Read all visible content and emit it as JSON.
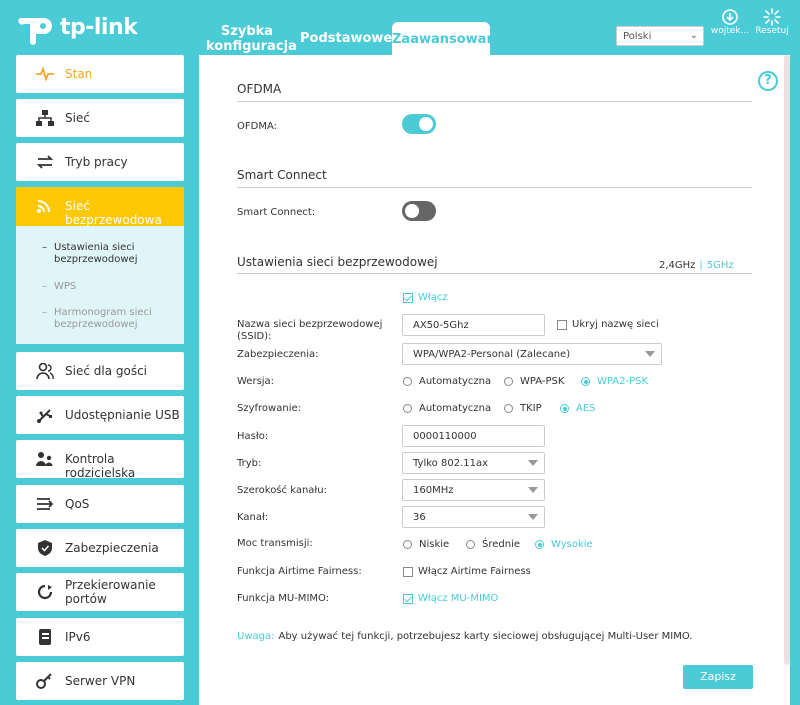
{
  "header": {
    "logo_text": "tp-link",
    "tabs": [
      {
        "label_line1": "Szybka",
        "label_line2": "konfiguracja"
      },
      {
        "label": "Podstawowe"
      },
      {
        "label": "Zaawansowane"
      }
    ],
    "language": "Polski",
    "user_label": "wojtek...",
    "reset_label": "Resetuj"
  },
  "sidebar": {
    "items": [
      {
        "label": "Stan",
        "icon": "pulse-icon"
      },
      {
        "label": "Sieć",
        "icon": "network-icon"
      },
      {
        "label": "Tryb pracy",
        "icon": "mode-switch-icon"
      },
      {
        "label": "Sieć bezprzewodowa",
        "icon": "wifi-icon"
      },
      {
        "label": "Sieć dla gości",
        "icon": "guests-icon"
      },
      {
        "label": "Udostępnianie USB",
        "icon": "usb-icon"
      },
      {
        "label": "Kontrola rodzicielska",
        "icon": "parental-icon"
      },
      {
        "label": "QoS",
        "icon": "qos-icon"
      },
      {
        "label": "Zabezpieczenia",
        "icon": "shield-icon"
      },
      {
        "label": "Przekierowanie portów",
        "icon": "port-forward-icon"
      },
      {
        "label": "IPv6",
        "icon": "ipv6-icon"
      },
      {
        "label": "Serwer VPN",
        "icon": "vpn-key-icon"
      }
    ],
    "submenu": [
      {
        "label": "Ustawienia sieci bezprzewodowej"
      },
      {
        "label": "WPS"
      },
      {
        "label": "Harmonogram sieci bezprzewodowej"
      }
    ]
  },
  "main": {
    "help_glyph": "?",
    "ofdma": {
      "title": "OFDMA",
      "label": "OFDMA:",
      "enabled": true
    },
    "smart_connect": {
      "title": "Smart Connect",
      "label": "Smart Connect:",
      "enabled": false
    },
    "wireless": {
      "title": "Ustawienia sieci bezprzewodowej",
      "band_24": "2,4GHz",
      "band_sep": "|",
      "band_5": "5GHz",
      "enable_label": "Włącz",
      "ssid_label": "Nazwa sieci bezprzewodowej (SSID):",
      "ssid_value": "AX50-5Ghz",
      "hide_ssid_label": "Ukryj nazwę sieci",
      "security_label": "Zabezpieczenia:",
      "security_value": "WPA/WPA2-Personal (Zalecane)",
      "version_label": "Wersja:",
      "version_options": [
        "Automatyczna",
        "WPA-PSK",
        "WPA2-PSK"
      ],
      "encryption_label": "Szyfrowanie:",
      "encryption_options": [
        "Automatyczna",
        "TKIP",
        "AES"
      ],
      "password_label": "Hasło:",
      "password_value": "0000110000",
      "mode_label": "Tryb:",
      "mode_value": "Tylko 802.11ax",
      "width_label": "Szerokość kanału:",
      "width_value": "160MHz",
      "channel_label": "Kanał:",
      "channel_value": "36",
      "power_label": "Moc transmisji:",
      "power_options": [
        "Niskie",
        "Średnie",
        "Wysokie"
      ],
      "airtime_label": "Funkcja Airtime Fairness:",
      "airtime_check_label": "Włącz Airtime Fairness",
      "mumimo_label": "Funkcja MU-MIMO:",
      "mumimo_check_label": "Włącz MU-MIMO"
    },
    "note_keyword": "Uwaga:",
    "note_text": "Aby używać tej funkcji, potrzebujesz karty sieciowej obsługującej Multi-User MIMO.",
    "save_label": "Zapisz"
  },
  "colors": {
    "accent": "#4acbd6",
    "active": "#ffc805",
    "orange": "#f5a623"
  }
}
